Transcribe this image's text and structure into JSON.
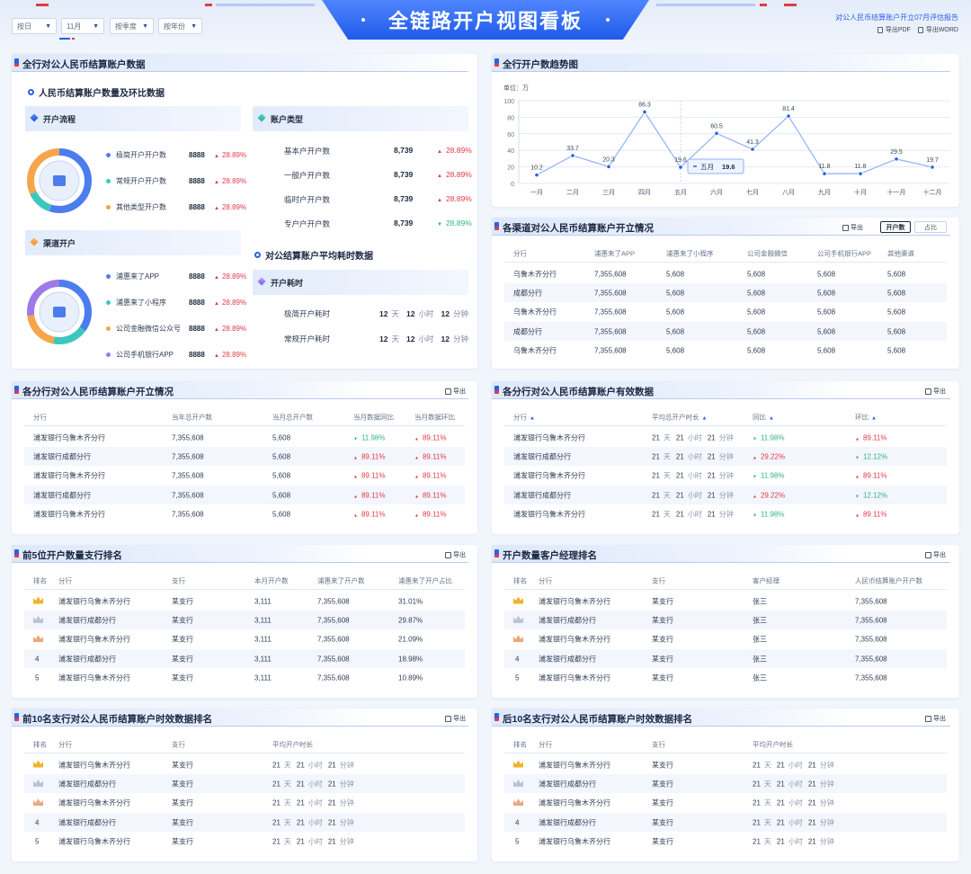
{
  "header": {
    "title": "全链路开户视图看板",
    "report_title": "对公人民币结算账户开立07月评估报告",
    "export_pdf": "导出PDF",
    "export_word": "导出WORD",
    "filters": [
      {
        "label": "按日"
      },
      {
        "label": "11月"
      },
      {
        "label": "按季度"
      },
      {
        "label": "按年份"
      }
    ]
  },
  "section_all": {
    "title": "全行对公人民币结算账户数据",
    "subtitle_rmb": "人民币结算账户数量及环比数据",
    "open_flow": {
      "title": "开户流程",
      "items": [
        {
          "label": "极简开户开户数",
          "value": "8888",
          "change": "28.89%",
          "color": "#4c7dee"
        },
        {
          "label": "常规开户开户数",
          "value": "8888",
          "change": "28.89%",
          "color": "#3cc7bd"
        },
        {
          "label": "其他类型开户数",
          "value": "8888",
          "change": "28.89%",
          "color": "#f6a54b"
        }
      ]
    },
    "channel_open": {
      "title": "渠道开户",
      "items": [
        {
          "label": "浦惠来了APP",
          "value": "8888",
          "change": "28.89%",
          "color": "#4c7dee"
        },
        {
          "label": "浦惠来了小程序",
          "value": "8888",
          "change": "28.89%",
          "color": "#3cc7bd"
        },
        {
          "label": "公司金融微信公众号",
          "value": "8888",
          "change": "28.89%",
          "color": "#f6a54b"
        },
        {
          "label": "公司手机银行APP",
          "value": "8888",
          "change": "28.89%",
          "color": "#9c7be8"
        }
      ]
    },
    "account_type": {
      "title": "账户类型",
      "items": [
        {
          "label": "基本户开户数",
          "value": "8,739",
          "change": "28.89%",
          "dir": "up"
        },
        {
          "label": "一般户开户数",
          "value": "8,739",
          "change": "28.89%",
          "dir": "up"
        },
        {
          "label": "临时户开户数",
          "value": "8,739",
          "change": "28.89%",
          "dir": "up"
        },
        {
          "label": "专户户开户数",
          "value": "8,739",
          "change": "28.89%",
          "dir": "down"
        }
      ]
    },
    "avg_time": {
      "subtitle": "对公结算账户平均耗时数据",
      "title": "开户耗时",
      "items": [
        {
          "label": "极简开户耗时",
          "d": "12",
          "h": "12",
          "m": "12"
        },
        {
          "label": "常规开户耗时",
          "d": "12",
          "h": "12",
          "m": "12"
        }
      ],
      "unit_day": "天",
      "unit_hour": "小时",
      "unit_min": "分钟"
    }
  },
  "trend": {
    "title": "全行开户数趋势图",
    "unit": "单位：万",
    "tooltip": {
      "label": "五月",
      "value": "19.6"
    }
  },
  "chart_data": {
    "type": "line",
    "categories": [
      "一月",
      "二月",
      "三月",
      "四月",
      "五月",
      "六月",
      "七月",
      "八月",
      "九月",
      "十月",
      "十一月",
      "十二月"
    ],
    "values": [
      10.2,
      33.7,
      20.3,
      86.3,
      19.6,
      60.5,
      41.3,
      81.4,
      11.8,
      11.8,
      29.5,
      19.7
    ],
    "ylim": [
      0,
      100
    ],
    "yticks": [
      0,
      20,
      40,
      60,
      80,
      100
    ],
    "grid": true,
    "title": "",
    "ylabel": "单位：万"
  },
  "channel_table": {
    "title": "各渠道对公人民币结算账户开立情况",
    "export": "导出",
    "toggle_a": "开户数",
    "toggle_b": "占比",
    "columns": [
      "分行",
      "浦惠来了APP",
      "浦惠来了小程序",
      "公司金融微信",
      "公司手机银行APP",
      "其他渠道"
    ],
    "rows": [
      [
        "乌鲁木齐分行",
        "7,355,608",
        "5,608",
        "5,608",
        "5,608",
        "5,608"
      ],
      [
        "成都分行",
        "7,355,608",
        "5,608",
        "5,608",
        "5,608",
        "5,608"
      ],
      [
        "乌鲁木齐分行",
        "7,355,608",
        "5,608",
        "5,608",
        "5,608",
        "5,608"
      ],
      [
        "成都分行",
        "7,355,608",
        "5,608",
        "5,608",
        "5,608",
        "5,608"
      ],
      [
        "乌鲁木齐分行",
        "7,355,608",
        "5,608",
        "5,608",
        "5,608",
        "5,608"
      ]
    ]
  },
  "branch_open": {
    "title": "各分行对公人民币结算账户开立情况",
    "export": "导出",
    "columns": [
      "分行",
      "当年总开户数",
      "当月总开户数",
      "当月数据同比",
      "当月数据环比"
    ],
    "rows": [
      {
        "name": "浦发银行乌鲁木齐分行",
        "year": "7,355,608",
        "month": "5,608",
        "yoy": "11.98%",
        "yoy_dir": "down",
        "mom": "89.11%",
        "mom_dir": "up"
      },
      {
        "name": "浦发银行成都分行",
        "year": "7,355,608",
        "month": "5,608",
        "yoy": "89.11%",
        "yoy_dir": "up",
        "mom": "89.11%",
        "mom_dir": "up"
      },
      {
        "name": "浦发银行乌鲁木齐分行",
        "year": "7,355,608",
        "month": "5,608",
        "yoy": "89.11%",
        "yoy_dir": "up",
        "mom": "89.11%",
        "mom_dir": "up"
      },
      {
        "name": "浦发银行成都分行",
        "year": "7,355,608",
        "month": "5,608",
        "yoy": "89.11%",
        "yoy_dir": "up",
        "mom": "89.11%",
        "mom_dir": "up"
      },
      {
        "name": "浦发银行乌鲁木齐分行",
        "year": "7,355,608",
        "month": "5,608",
        "yoy": "89.11%",
        "yoy_dir": "up",
        "mom": "89.11%",
        "mom_dir": "up"
      }
    ]
  },
  "branch_valid": {
    "title": "各分行对公人民币结算账户有效数据",
    "export": "导出",
    "columns": [
      "分行",
      "平均总开户时长",
      "同比",
      "环比"
    ],
    "rows": [
      {
        "name": "浦发银行乌鲁木齐分行",
        "d": "21",
        "h": "21",
        "m": "21",
        "yoy": "11.98%",
        "yoy_dir": "down",
        "mom": "89.11%",
        "mom_dir": "up"
      },
      {
        "name": "浦发银行成都分行",
        "d": "21",
        "h": "21",
        "m": "21",
        "yoy": "29.22%",
        "yoy_dir": "up",
        "mom": "12.12%",
        "mom_dir": "down"
      },
      {
        "name": "浦发银行乌鲁木齐分行",
        "d": "21",
        "h": "21",
        "m": "21",
        "yoy": "11.98%",
        "yoy_dir": "down",
        "mom": "89.11%",
        "mom_dir": "up"
      },
      {
        "name": "浦发银行成都分行",
        "d": "21",
        "h": "21",
        "m": "21",
        "yoy": "29.22%",
        "yoy_dir": "up",
        "mom": "12.12%",
        "mom_dir": "down"
      },
      {
        "name": "浦发银行乌鲁木齐分行",
        "d": "21",
        "h": "21",
        "m": "21",
        "yoy": "11.98%",
        "yoy_dir": "down",
        "mom": "89.11%",
        "mom_dir": "up"
      }
    ]
  },
  "top5_branch": {
    "title": "前5位开户数量支行排名",
    "export": "导出",
    "columns": [
      "排名",
      "分行",
      "支行",
      "本月开户数",
      "浦惠来了开户数",
      "浦惠来了开户占比"
    ],
    "rows": [
      {
        "rank": "1",
        "name": "浦发银行乌鲁木齐分行",
        "sub": "某支行",
        "month": "3,111",
        "puhui": "7,355,608",
        "ratio": "31.01%"
      },
      {
        "rank": "2",
        "name": "浦发银行成都分行",
        "sub": "某支行",
        "month": "3,111",
        "puhui": "7,355,608",
        "ratio": "29.87%"
      },
      {
        "rank": "3",
        "name": "浦发银行乌鲁木齐分行",
        "sub": "某支行",
        "month": "3,111",
        "puhui": "7,355,608",
        "ratio": "21.09%"
      },
      {
        "rank": "4",
        "name": "浦发银行成都分行",
        "sub": "某支行",
        "month": "3,111",
        "puhui": "7,355,608",
        "ratio": "18.98%"
      },
      {
        "rank": "5",
        "name": "浦发银行乌鲁木齐分行",
        "sub": "某支行",
        "month": "3,111",
        "puhui": "7,355,608",
        "ratio": "10.89%"
      }
    ]
  },
  "manager_rank": {
    "title": "开户数量客户经理排名",
    "export": "导出",
    "columns": [
      "排名",
      "分行",
      "支行",
      "客户经理",
      "人民币结算账户开户数"
    ],
    "rows": [
      {
        "rank": "1",
        "name": "浦发银行乌鲁木齐分行",
        "sub": "某支行",
        "mgr": "张三",
        "count": "7,355,608"
      },
      {
        "rank": "2",
        "name": "浦发银行成都分行",
        "sub": "某支行",
        "mgr": "张三",
        "count": "7,355,608"
      },
      {
        "rank": "3",
        "name": "浦发银行乌鲁木齐分行",
        "sub": "某支行",
        "mgr": "张三",
        "count": "7,355,608"
      },
      {
        "rank": "4",
        "name": "浦发银行成都分行",
        "sub": "某支行",
        "mgr": "张三",
        "count": "7,355,608"
      },
      {
        "rank": "5",
        "name": "浦发银行乌鲁木齐分行",
        "sub": "某支行",
        "mgr": "张三",
        "count": "7,355,608"
      }
    ]
  },
  "top10_time": {
    "title": "前10名支行对公人民币结算账户时效数据排名",
    "export": "导出",
    "columns": [
      "排名",
      "分行",
      "支行",
      "平均开户时长"
    ],
    "rows": [
      {
        "rank": "1",
        "name": "浦发银行乌鲁木齐分行",
        "sub": "某支行",
        "d": "21",
        "h": "21",
        "m": "21"
      },
      {
        "rank": "2",
        "name": "浦发银行成都分行",
        "sub": "某支行",
        "d": "21",
        "h": "21",
        "m": "21"
      },
      {
        "rank": "3",
        "name": "浦发银行乌鲁木齐分行",
        "sub": "某支行",
        "d": "21",
        "h": "21",
        "m": "21"
      },
      {
        "rank": "4",
        "name": "浦发银行成都分行",
        "sub": "某支行",
        "d": "21",
        "h": "21",
        "m": "21"
      },
      {
        "rank": "5",
        "name": "浦发银行乌鲁木齐分行",
        "sub": "某支行",
        "d": "21",
        "h": "21",
        "m": "21"
      }
    ]
  },
  "bottom10_time": {
    "title": "后10名支行对公人民币结算账户时效数据排名",
    "export": "导出",
    "columns": [
      "排名",
      "分行",
      "支行",
      "平均开户时长"
    ],
    "rows": [
      {
        "rank": "1",
        "name": "浦发银行乌鲁木齐分行",
        "sub": "某支行",
        "d": "21",
        "h": "21",
        "m": "21"
      },
      {
        "rank": "2",
        "name": "浦发银行成都分行",
        "sub": "某支行",
        "d": "21",
        "h": "21",
        "m": "21"
      },
      {
        "rank": "3",
        "name": "浦发银行乌鲁木齐分行",
        "sub": "某支行",
        "d": "21",
        "h": "21",
        "m": "21"
      },
      {
        "rank": "4",
        "name": "浦发银行成都分行",
        "sub": "某支行",
        "d": "21",
        "h": "21",
        "m": "21"
      },
      {
        "rank": "5",
        "name": "浦发银行乌鲁木齐分行",
        "sub": "某支行",
        "d": "21",
        "h": "21",
        "m": "21"
      }
    ]
  },
  "units": {
    "day": "天",
    "hour": "小时",
    "minute": "分钟"
  }
}
